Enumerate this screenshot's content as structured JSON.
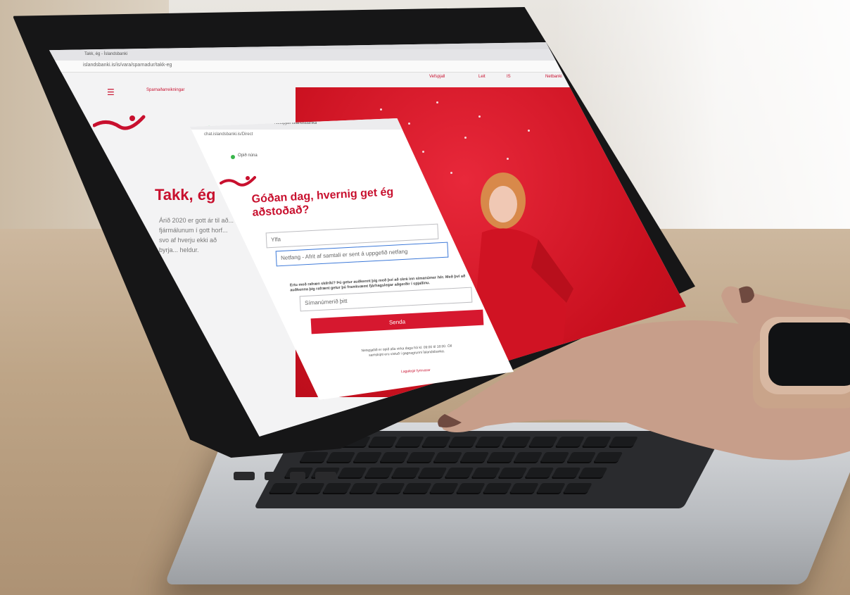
{
  "scene": {
    "description_colors": {
      "brand_red": "#c8102e",
      "table": "#bea587",
      "laptop_silver": "#b8bbbf"
    }
  },
  "browser": {
    "tab_title": "Takk, ég - Íslandsbanki",
    "url": "islandsbanki.is/is/vara/sparnadur/takk-eg"
  },
  "site": {
    "nav_link": "Sparnaðarreikningar",
    "top_links": [
      "Netbanki",
      "IS",
      "Leit",
      "Vefspjall"
    ],
    "headline": "Takk, ég",
    "body_text": "Árið 2020 er gott ár til að... fjármálunum í gott horf... svo af hverju ekki að byrja... heldur."
  },
  "chat": {
    "window_title": "Netspjall Íslandsbanka",
    "url": "chat.islandsbanki.is/Direct",
    "status": "Opið núna",
    "heading": "Góðan dag, hvernig get ég aðstoðað?",
    "name_value": "Ylfa",
    "email_placeholder": "Netfang - Afrit af samtali er sent á uppgefið netfang",
    "phone_note": "Ertu með rafræn skilríki? Þú getur auðkennt þig með því að skrá inn símanúmer hér. Með því að auðkenna þig rafrænt getur þú framkvæmt fjárhagslegar aðgerðir í spjallinu.",
    "phone_placeholder": "Símanúmerið þitt",
    "send_label": "Senda",
    "hours_text": "Netspjallið er opið alla virka daga frá kl. 09:00 til 18:00. Öll samskipti eru vistuð í gagnagrunni Íslandsbanka.",
    "legal_link": "Lagalegir fyrirvarar"
  }
}
